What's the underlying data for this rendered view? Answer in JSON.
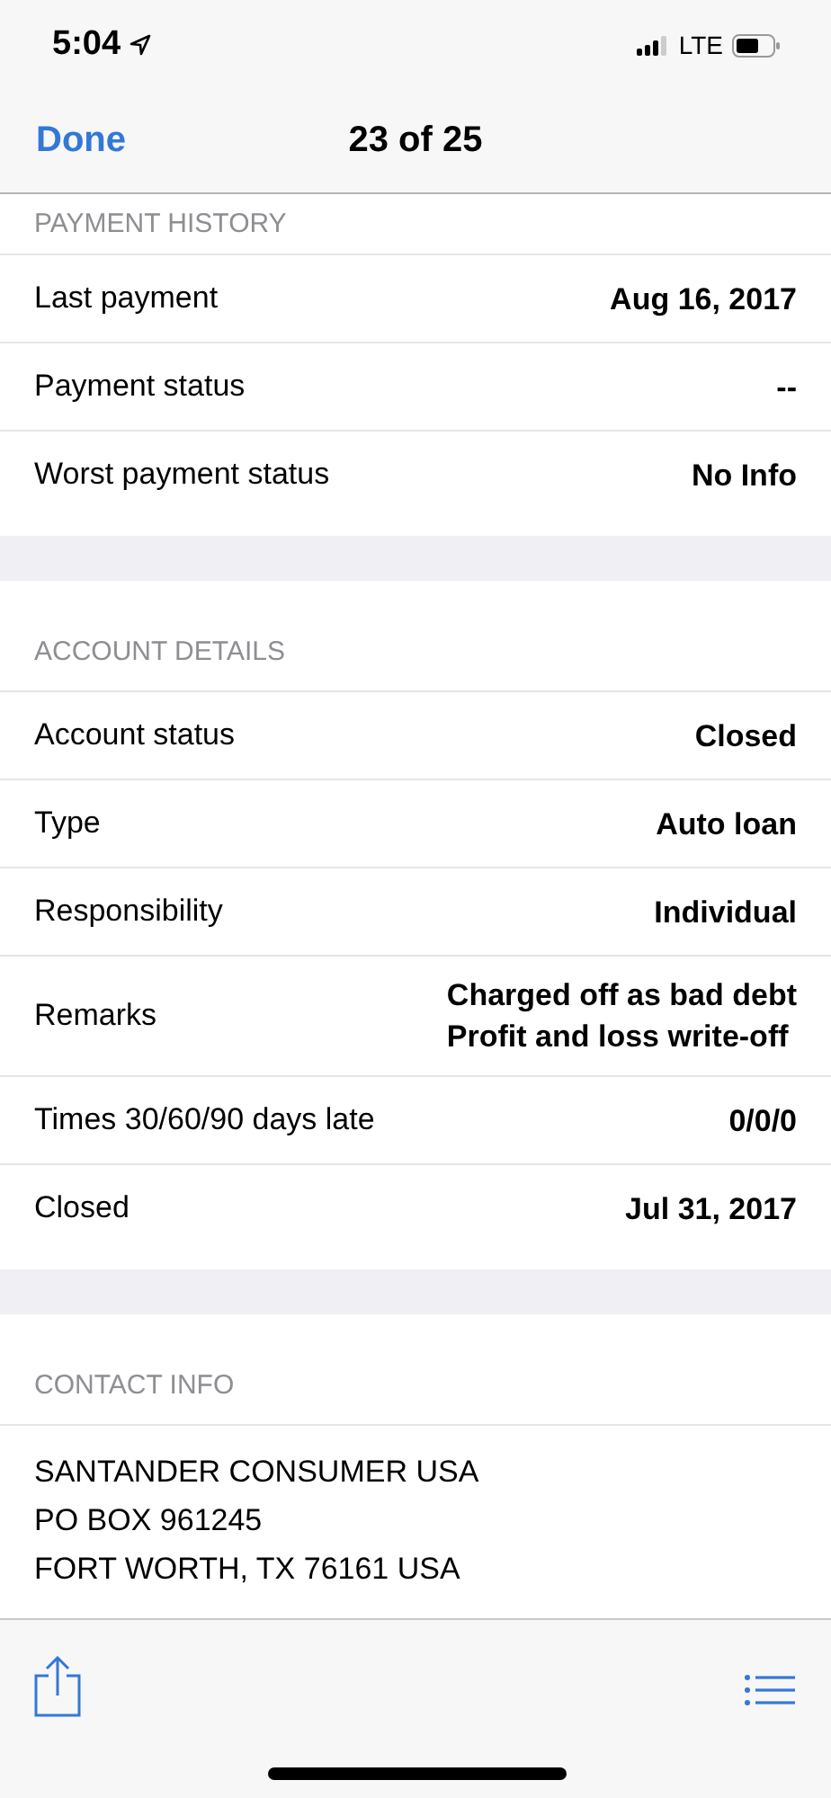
{
  "status_bar": {
    "time": "5:04",
    "network": "LTE"
  },
  "nav": {
    "done": "Done",
    "title": "23 of 25"
  },
  "sections": [
    {
      "title": "PAYMENT HISTORY",
      "kind": "rows",
      "rows": [
        {
          "label": "Last payment",
          "values": [
            "Aug 16, 2017"
          ]
        },
        {
          "label": "Payment status",
          "values": [
            "--"
          ]
        },
        {
          "label": "Worst payment status",
          "values": [
            "No Info"
          ]
        }
      ]
    },
    {
      "title": "ACCOUNT DETAILS",
      "kind": "rows",
      "rows": [
        {
          "label": "Account status",
          "values": [
            "Closed"
          ]
        },
        {
          "label": "Type",
          "values": [
            "Auto loan"
          ]
        },
        {
          "label": "Responsibility",
          "values": [
            "Individual"
          ]
        },
        {
          "label": "Remarks",
          "values": [
            "Charged off as bad debt",
            "Profit and loss write-off"
          ]
        },
        {
          "label": "Times 30/60/90 days late",
          "values": [
            "0/0/0"
          ]
        },
        {
          "label": "Closed",
          "values": [
            "Jul 31, 2017"
          ]
        }
      ]
    },
    {
      "title": "CONTACT INFO",
      "kind": "address",
      "lines": [
        "SANTANDER CONSUMER USA",
        "PO BOX 961245",
        "FORT WORTH, TX 76161 USA"
      ]
    }
  ]
}
